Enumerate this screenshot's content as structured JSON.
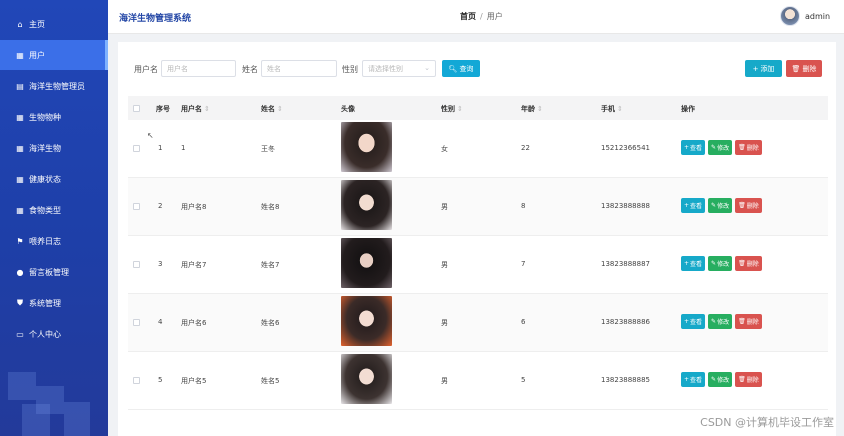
{
  "sidebar": {
    "items": [
      {
        "label": "主页",
        "icon": "home-icon",
        "glyph": "⌂"
      },
      {
        "label": "用户",
        "icon": "grid-icon",
        "glyph": "▦"
      },
      {
        "label": "海洋生物管理员",
        "icon": "clipboard-icon",
        "glyph": "▤"
      },
      {
        "label": "生物物种",
        "icon": "grid-icon",
        "glyph": "▦"
      },
      {
        "label": "海洋生物",
        "icon": "grid-icon",
        "glyph": "▦"
      },
      {
        "label": "健康状态",
        "icon": "grid-icon",
        "glyph": "▦"
      },
      {
        "label": "食物类型",
        "icon": "grid-icon",
        "glyph": "▦"
      },
      {
        "label": "喂养日志",
        "icon": "flag-icon",
        "glyph": "⚑"
      },
      {
        "label": "留言板管理",
        "icon": "bulb-icon",
        "glyph": "●"
      },
      {
        "label": "系统管理",
        "icon": "shield-icon",
        "glyph": "⛊"
      },
      {
        "label": "个人中心",
        "icon": "window-icon",
        "glyph": "▭"
      }
    ],
    "active_index": 1
  },
  "header": {
    "title": "海洋生物管理系统",
    "breadcrumb_home": "首页",
    "breadcrumb_sep": "/",
    "breadcrumb_current": "用户",
    "username": "admin"
  },
  "search": {
    "username_label": "用户名",
    "username_placeholder": "用户名",
    "name_label": "姓名",
    "name_placeholder": "姓名",
    "gender_label": "性别",
    "gender_placeholder": "请选择性别",
    "query_label": "查询",
    "add_label": "添加",
    "delete_label": "删除"
  },
  "table": {
    "columns": {
      "index": "序号",
      "username": "用户名",
      "name": "姓名",
      "avatar": "头像",
      "gender": "性别",
      "age": "年龄",
      "phone": "手机",
      "actions": "操作"
    },
    "action_labels": {
      "view": "查看",
      "edit": "修改",
      "delete": "删除"
    },
    "rows": [
      {
        "index": "1",
        "username": "1",
        "name": "王冬",
        "gender": "女",
        "age": "22",
        "phone": "15212366541"
      },
      {
        "index": "2",
        "username": "用户名8",
        "name": "姓名8",
        "gender": "男",
        "age": "8",
        "phone": "13823888888"
      },
      {
        "index": "3",
        "username": "用户名7",
        "name": "姓名7",
        "gender": "男",
        "age": "7",
        "phone": "13823888887"
      },
      {
        "index": "4",
        "username": "用户名6",
        "name": "姓名6",
        "gender": "男",
        "age": "6",
        "phone": "13823888886"
      },
      {
        "index": "5",
        "username": "用户名5",
        "name": "姓名5",
        "gender": "男",
        "age": "5",
        "phone": "13823888885"
      }
    ]
  },
  "colors": {
    "sidebar_bg": "#2147b8",
    "sidebar_active": "#3b6fe8",
    "primary_cyan": "#16a9c9",
    "edit_green": "#27ae60",
    "danger_red": "#d9534f"
  },
  "watermark": "CSDN @计算机毕设工作室"
}
